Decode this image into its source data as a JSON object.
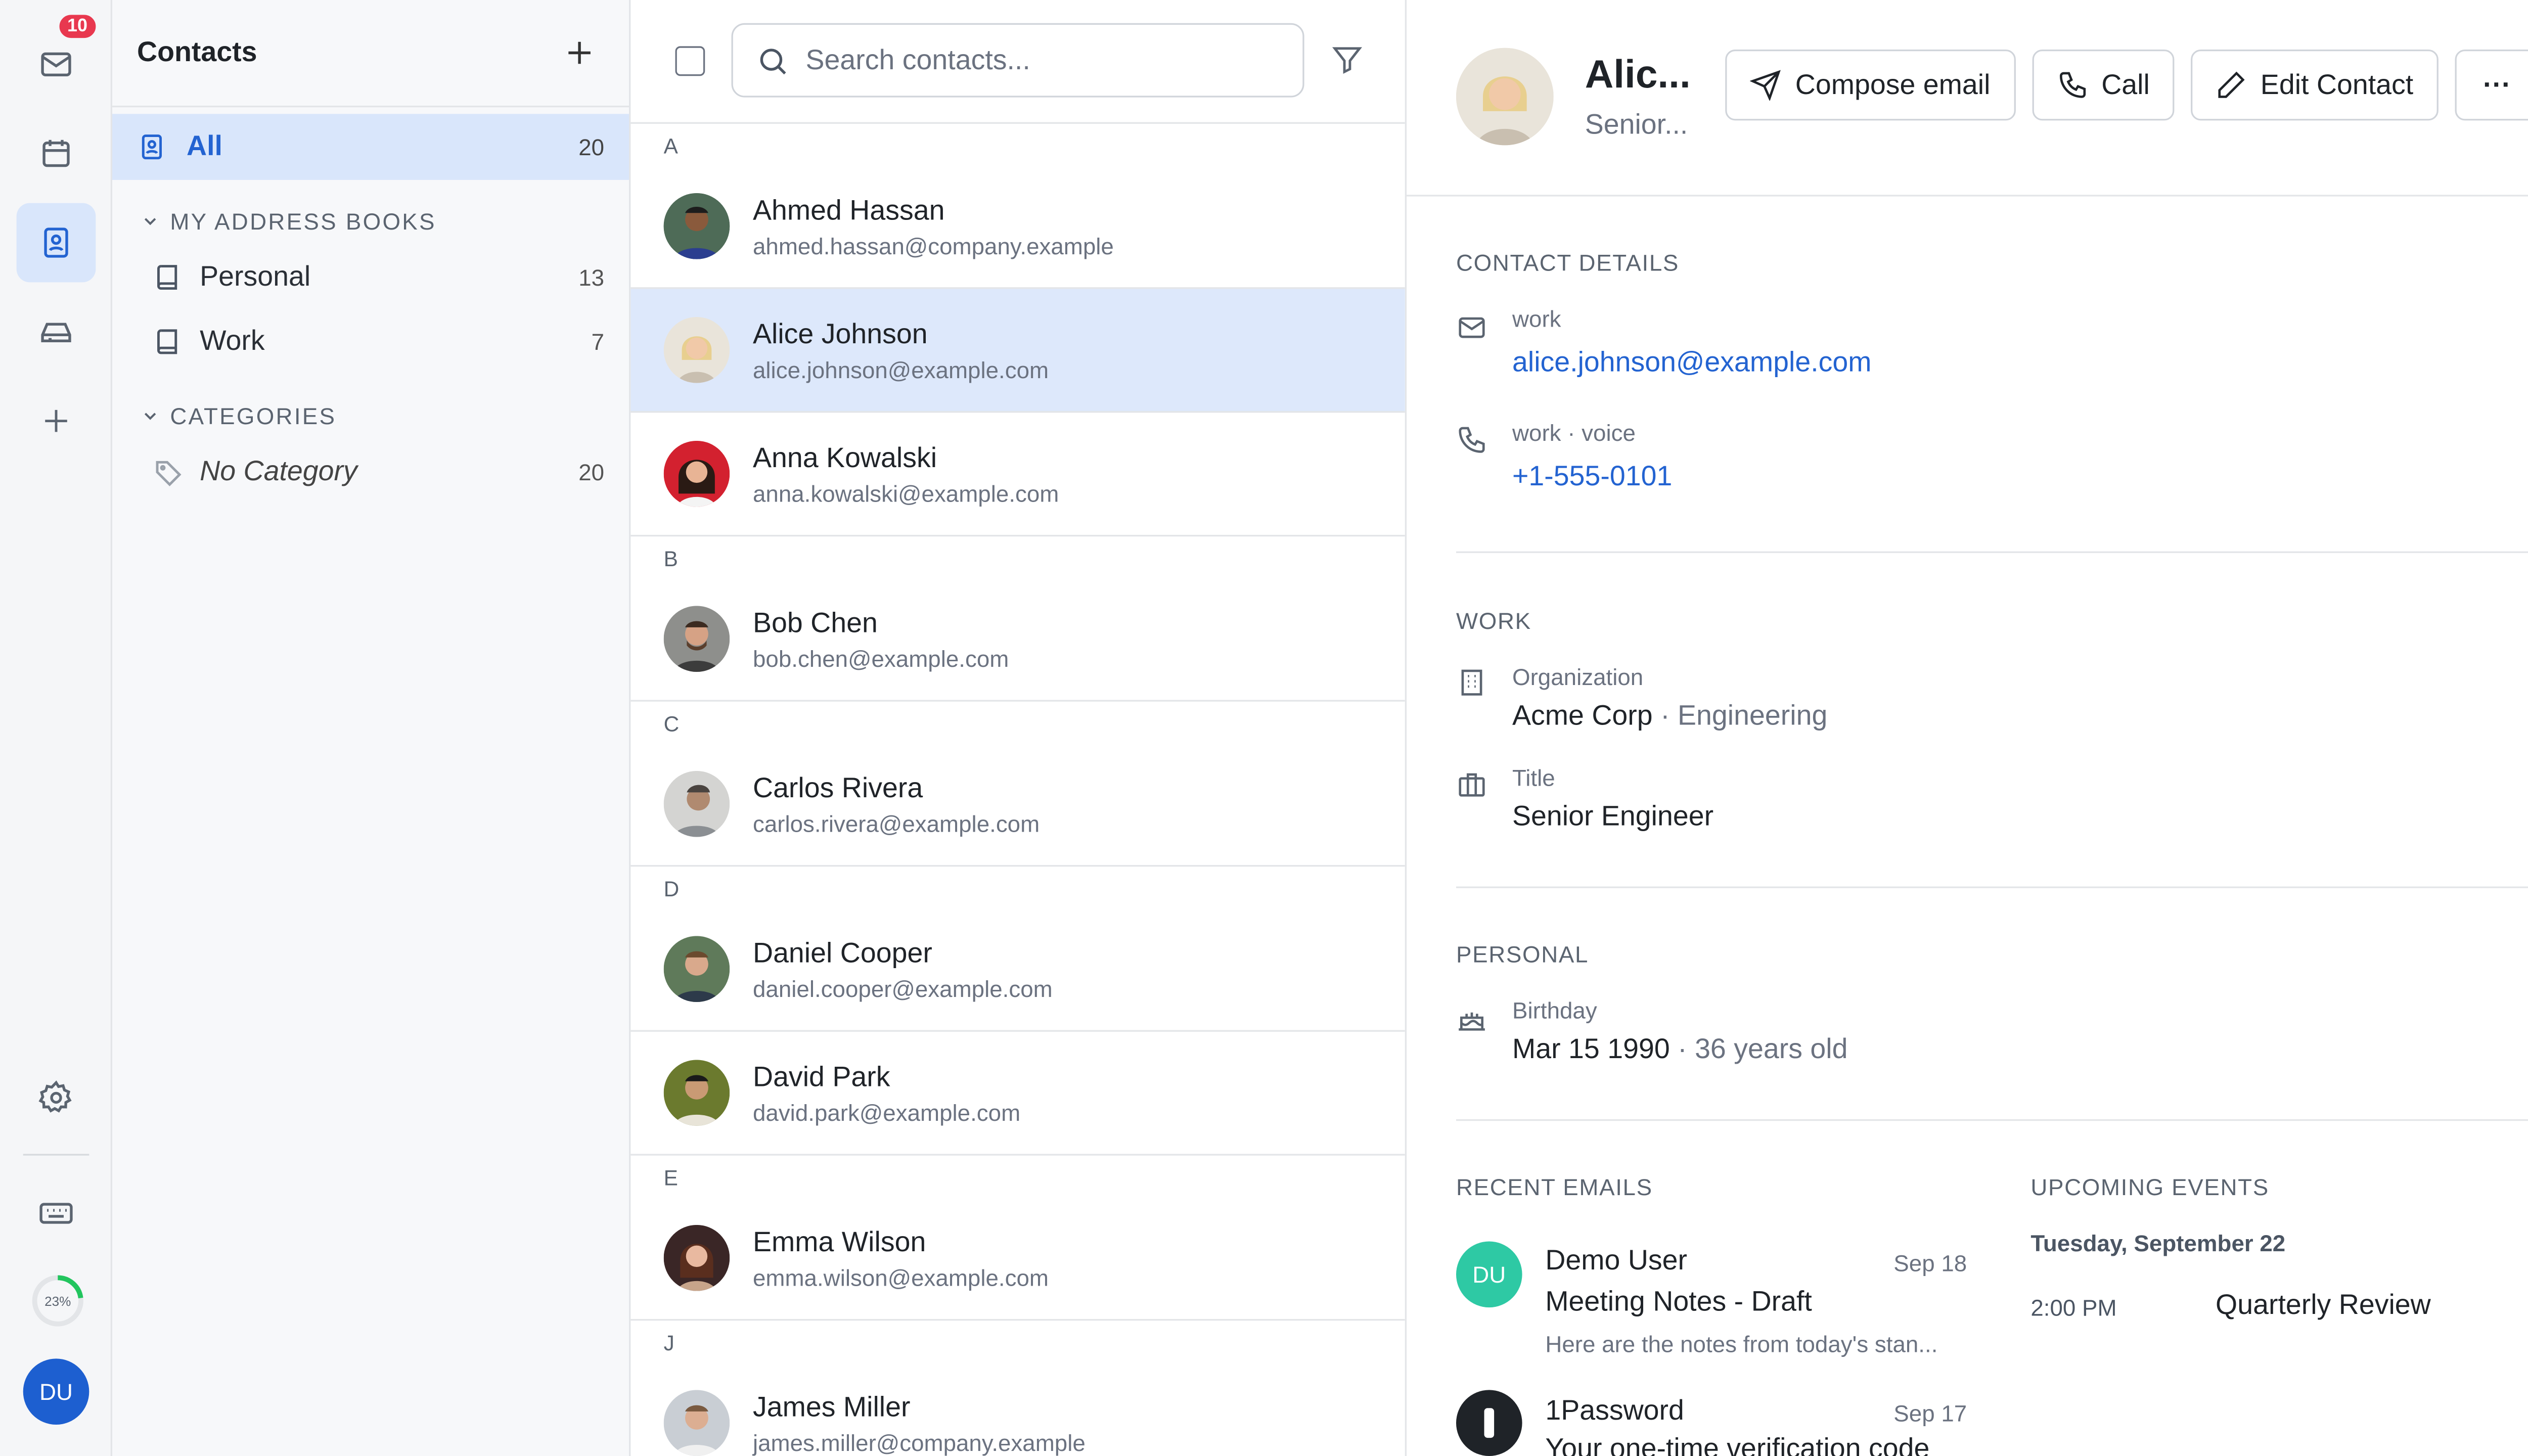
{
  "rail": {
    "mail_badge": "10",
    "quota_label": "23%",
    "quota_percent": 23,
    "user_initials": "DU",
    "accent": "#2363d1",
    "quota_color": "#22c55e"
  },
  "folders": {
    "title": "Contacts",
    "all_label": "All",
    "all_count": "20",
    "address_books_header": "MY ADDRESS BOOKS",
    "books": [
      {
        "label": "Personal",
        "count": "13"
      },
      {
        "label": "Work",
        "count": "7"
      }
    ],
    "categories_header": "CATEGORIES",
    "categories": [
      {
        "label": "No Category",
        "count": "20"
      }
    ]
  },
  "list": {
    "search_placeholder": "Search contacts...",
    "groups": [
      {
        "letter": "A",
        "contacts": [
          {
            "name": "Ahmed Hassan",
            "email": "ahmed.hassan@company.example"
          },
          {
            "name": "Alice Johnson",
            "email": "alice.johnson@example.com"
          },
          {
            "name": "Anna Kowalski",
            "email": "anna.kowalski@example.com"
          }
        ]
      },
      {
        "letter": "B",
        "contacts": [
          {
            "name": "Bob Chen",
            "email": "bob.chen@example.com"
          }
        ]
      },
      {
        "letter": "C",
        "contacts": [
          {
            "name": "Carlos Rivera",
            "email": "carlos.rivera@example.com"
          }
        ]
      },
      {
        "letter": "D",
        "contacts": [
          {
            "name": "Daniel Cooper",
            "email": "daniel.cooper@example.com"
          },
          {
            "name": "David Park",
            "email": "david.park@example.com"
          }
        ]
      },
      {
        "letter": "E",
        "contacts": [
          {
            "name": "Emma Wilson",
            "email": "emma.wilson@example.com"
          }
        ]
      },
      {
        "letter": "J",
        "contacts": [
          {
            "name": "James Miller",
            "email": "james.miller@company.example"
          }
        ]
      }
    ]
  },
  "detail": {
    "name": "Alic...",
    "subtitle": "Senior...",
    "actions": {
      "compose": "Compose email",
      "call": "Call",
      "edit": "Edit Contact",
      "more": "···"
    },
    "contact_details_title": "CONTACT DETAILS",
    "email_label": "work",
    "email_value": "alice.johnson@example.com",
    "phone_label": "work · voice",
    "phone_value": "+1-555-0101",
    "work_title": "WORK",
    "org_label": "Organization",
    "org_value": "Acme Corp",
    "org_dept": "· Engineering",
    "title_label": "Title",
    "title_value": "Senior Engineer",
    "personal_title": "PERSONAL",
    "birthday_label": "Birthday",
    "birthday_value": "Mar 15 1990",
    "birthday_age": "· 36 years old",
    "recent_emails_title": "RECENT EMAILS",
    "emails": [
      {
        "initials": "DU",
        "from": "Demo User",
        "date": "Sep 18",
        "subject": "Meeting Notes - Draft",
        "preview": "Here are the notes from today's stan..."
      },
      {
        "initials": "",
        "from": "1Password",
        "date": "Sep 17",
        "subject": "Your one-time verification code",
        "preview": ""
      }
    ],
    "upcoming_title": "UPCOMING EVENTS",
    "event_day": "Tuesday, September 22",
    "event_time": "2:00 PM",
    "event_title": "Quarterly Review"
  }
}
